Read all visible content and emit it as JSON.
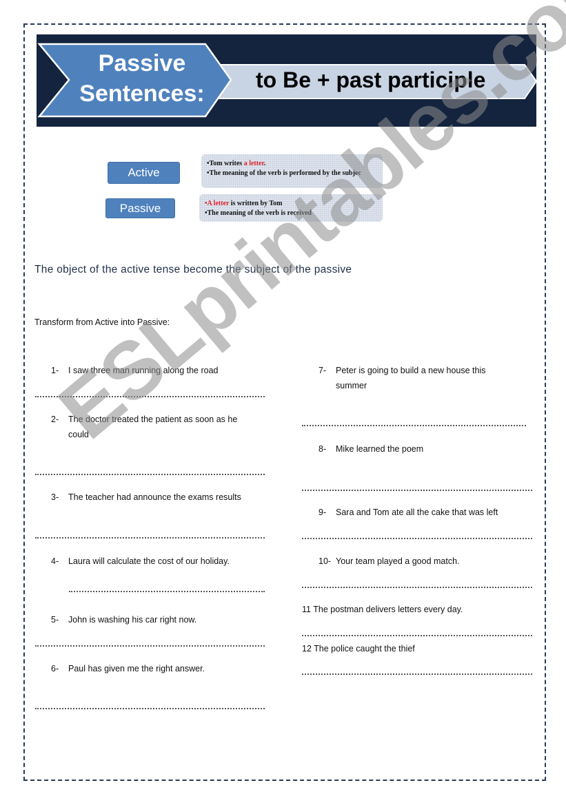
{
  "banner": {
    "title_line1": "Passive",
    "title_line2": "Sentences:",
    "formula": "to Be + past participle",
    "colors": {
      "background": "#14243f",
      "chevron": "#4f81bd",
      "arrow": "#c8d3e3"
    }
  },
  "comparison": {
    "active": {
      "label": "Active",
      "example_prefix": "Tom writes ",
      "example_highlight": "a letter",
      "example_suffix": ".",
      "meaning": "The meaning of the verb is performed by the subjec"
    },
    "passive": {
      "label": "Passive",
      "example_highlight": "A letter",
      "example_suffix": " is written by Tom",
      "meaning": "The meaning of the verb is received"
    },
    "highlight_color": "#e0202a",
    "bullet": "•"
  },
  "rule": "The object of the active tense become the subject of the passive",
  "instruction": "Transform from Active into Passive:",
  "exercises_left": [
    {
      "num": "1-",
      "text": "I saw three man running along the road"
    },
    {
      "num": "2-",
      "text": "The doctor treated the patient as soon as he could"
    },
    {
      "num": "3-",
      "text": "The teacher had announce the exams results"
    },
    {
      "num": "4-",
      "text": "Laura will calculate the cost of our holiday."
    },
    {
      "num": "5-",
      "text": "John is washing his car right now."
    },
    {
      "num": "6-",
      "text": "Paul has given me  the right answer."
    }
  ],
  "exercises_right": [
    {
      "num": "7-",
      "text": "Peter is going to build a new house this summer"
    },
    {
      "num": "8-",
      "text": "Mike learned  the poem"
    },
    {
      "num": "9-",
      "text": "Sara and Tom  ate all the cake that  was left"
    },
    {
      "num": "10-",
      "text": "Your team played a good match."
    },
    {
      "num": "11",
      "text": "The postman delivers letters every day."
    },
    {
      "num": "12",
      "text": "The police caught the thief"
    }
  ],
  "watermark": "ESLprintables.com"
}
